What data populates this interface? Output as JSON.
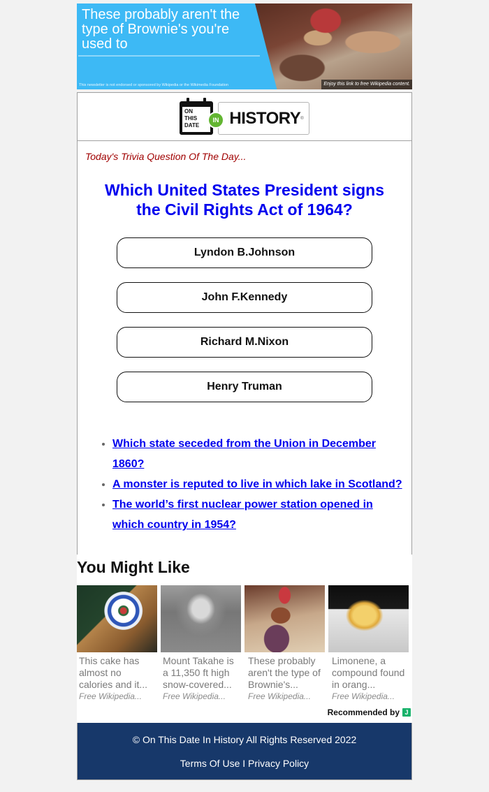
{
  "banner": {
    "headline": "These probably aren't the type of Brownie's you're used to",
    "disclaimer": "This newsletter is not endorsed or sponsored by Wikipedia or the Wikimedia Foundation",
    "caption": "Enjoy this link to free Wikipedia content."
  },
  "logo": {
    "calendar_text": [
      "ON",
      "THIS",
      "DATE"
    ],
    "in_badge": "IN",
    "wordmark": "HISTORY",
    "trademark": "®"
  },
  "trivia": {
    "label": "Today's Trivia Question Of The Day...",
    "question": "Which United States President signs the Civil Rights Act of 1964?",
    "answers": [
      "Lyndon B.Johnson",
      "John F.Kennedy",
      "Richard M.Nixon",
      "Henry Truman"
    ]
  },
  "related_questions": [
    "Which state seceded from the Union in December 1860?",
    "A monster is reputed to live in which lake in Scotland?",
    "The world’s first nuclear power station opened in which country in 1954?"
  ],
  "you_might_like": {
    "heading": "You Might Like",
    "items": [
      {
        "title": "This cake has almost no calories and it...",
        "source": "Free Wikipedia..."
      },
      {
        "title": "Mount Takahe is a 11,350 ft high snow-covered...",
        "source": "Free Wikipedia..."
      },
      {
        "title": "These probably aren't the type of Brownie's...",
        "source": "Free Wikipedia..."
      },
      {
        "title": "Limonene, a compound found in orang...",
        "source": "Free Wikipedia..."
      }
    ],
    "recommended_by": "Recommended by",
    "provider_icon": "J"
  },
  "footer": {
    "copyright": "© On This Date In History All Rights Reserved 2022",
    "terms": "Terms Of Use",
    "separator": "I",
    "privacy": "Privacy Policy"
  },
  "colors": {
    "banner_bg": "#3db9f5",
    "question": "#0000ee",
    "trivia_label": "#a00000",
    "footer_bg": "#17386a",
    "in_badge": "#62b531"
  }
}
